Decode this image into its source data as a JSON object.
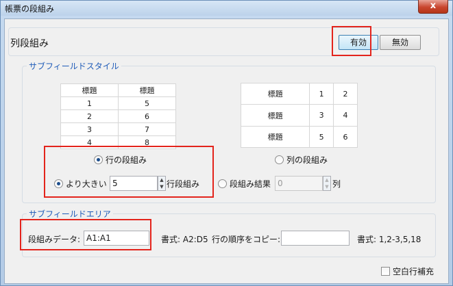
{
  "window": {
    "title": "帳票の段組み",
    "close_glyph": "x"
  },
  "column_mode": {
    "label": "列段組み",
    "enable_label": "有効",
    "disable_label": "無効",
    "selected": "有効"
  },
  "subfield_style": {
    "legend": "サブフィールドスタイル",
    "row_table": {
      "headers": [
        "標題",
        "標題"
      ],
      "rows": [
        [
          "1",
          "5"
        ],
        [
          "2",
          "6"
        ],
        [
          "3",
          "7"
        ],
        [
          "4",
          "8"
        ]
      ]
    },
    "col_table": {
      "rows": [
        [
          "標題",
          "1",
          "2"
        ],
        [
          "標題",
          "3",
          "4"
        ],
        [
          "標題",
          "5",
          "6"
        ]
      ]
    },
    "row_layout_label": "行の段組み",
    "col_layout_label": "列の段組み",
    "greater_than_label": "より大きい",
    "greater_than_value": "5",
    "row_suffix": "行段組み",
    "result_label": "段組み結果",
    "result_value": "0",
    "col_suffix": "列",
    "selected_layout": "row"
  },
  "subfield_area": {
    "legend": "サブフィールドエリア",
    "data_label": "段組みデータ:",
    "data_value": "A1:A1",
    "format1": "書式: A2:D5",
    "copy_label": "行の順序をコピー:",
    "copy_value": "",
    "format2": "書式: 1,2-3,5,18"
  },
  "fill_blank": {
    "label": "空白行補充",
    "checked": false
  }
}
